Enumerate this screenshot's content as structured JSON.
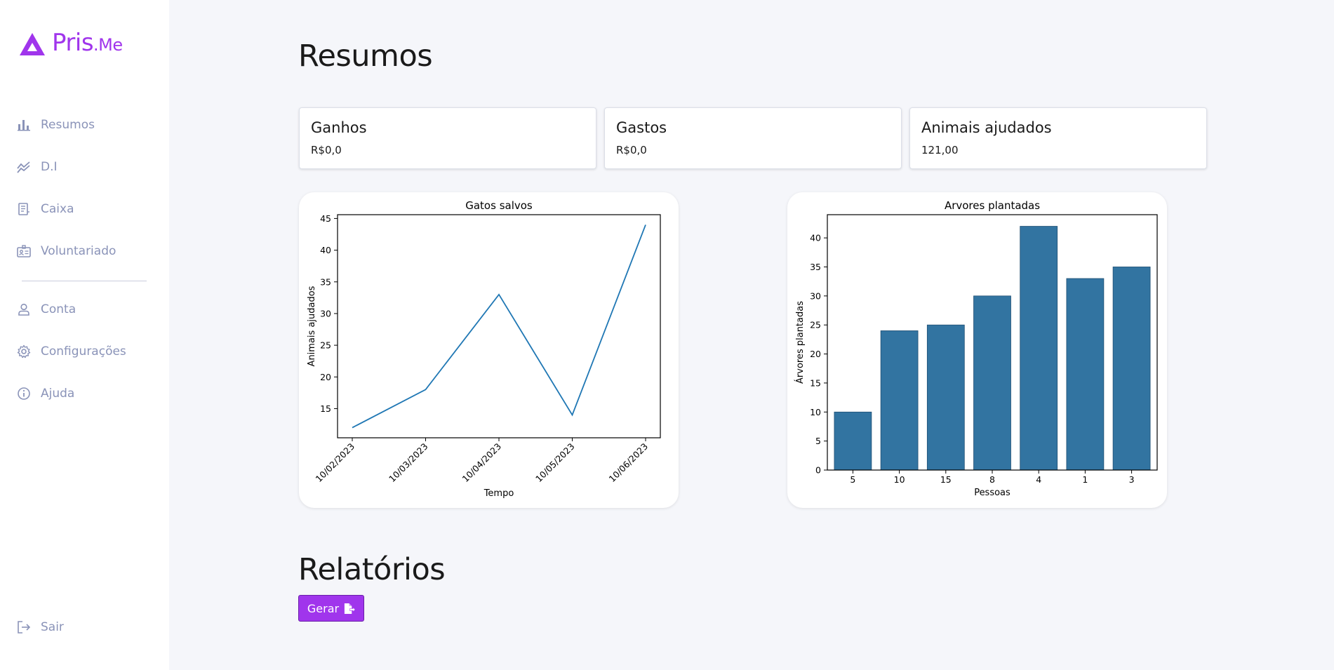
{
  "app": {
    "logo_text": "Pris",
    "logo_suffix": ".Me",
    "brand_color": "#a035ec"
  },
  "sidebar": {
    "items": [
      {
        "label": "Resumos",
        "icon": "bar-chart-icon"
      },
      {
        "label": "D.I",
        "icon": "trend-lines-icon"
      },
      {
        "label": "Caixa",
        "icon": "receipt-icon"
      },
      {
        "label": "Voluntariado",
        "icon": "id-card-icon"
      },
      {
        "label": "Conta",
        "icon": "user-icon"
      },
      {
        "label": "Configurações",
        "icon": "gear-icon"
      },
      {
        "label": "Ajuda",
        "icon": "info-icon"
      }
    ],
    "logout": {
      "label": "Sair",
      "icon": "logout-icon"
    }
  },
  "main": {
    "title": "Resumos",
    "cards": [
      {
        "title": "Ganhos",
        "value": "R$0,0"
      },
      {
        "title": "Gastos",
        "value": "R$0,0"
      },
      {
        "title": "Animais ajudados",
        "value": "121,00"
      }
    ]
  },
  "reports": {
    "title": "Relatórios",
    "button_label": "Gerar",
    "button_icon": "file-export-icon"
  },
  "chart_data": [
    {
      "type": "line",
      "title": "Gatos salvos",
      "xlabel": "Tempo",
      "ylabel": "Animais ajudados",
      "x": [
        "10/02/2023",
        "10/03/2023",
        "10/04/2023",
        "10/05/2023",
        "10/06/2023"
      ],
      "values": [
        12,
        18,
        33,
        14,
        44
      ],
      "yticks": [
        15,
        20,
        25,
        30,
        35,
        40,
        45
      ],
      "ylim": [
        10.4,
        45.6
      ],
      "color": "#1f77b4",
      "grid": false
    },
    {
      "type": "bar",
      "title": "Arvores plantadas",
      "xlabel": "Pessoas",
      "ylabel": "Árvores plantadas",
      "categories": [
        "5",
        "10",
        "15",
        "8",
        "4",
        "1",
        "3"
      ],
      "values": [
        10,
        24,
        25,
        30,
        42,
        33,
        35
      ],
      "yticks": [
        0,
        5,
        10,
        15,
        20,
        25,
        30,
        35,
        40
      ],
      "ylim": [
        0,
        44
      ],
      "color": "#3274a1",
      "grid": false
    }
  ]
}
